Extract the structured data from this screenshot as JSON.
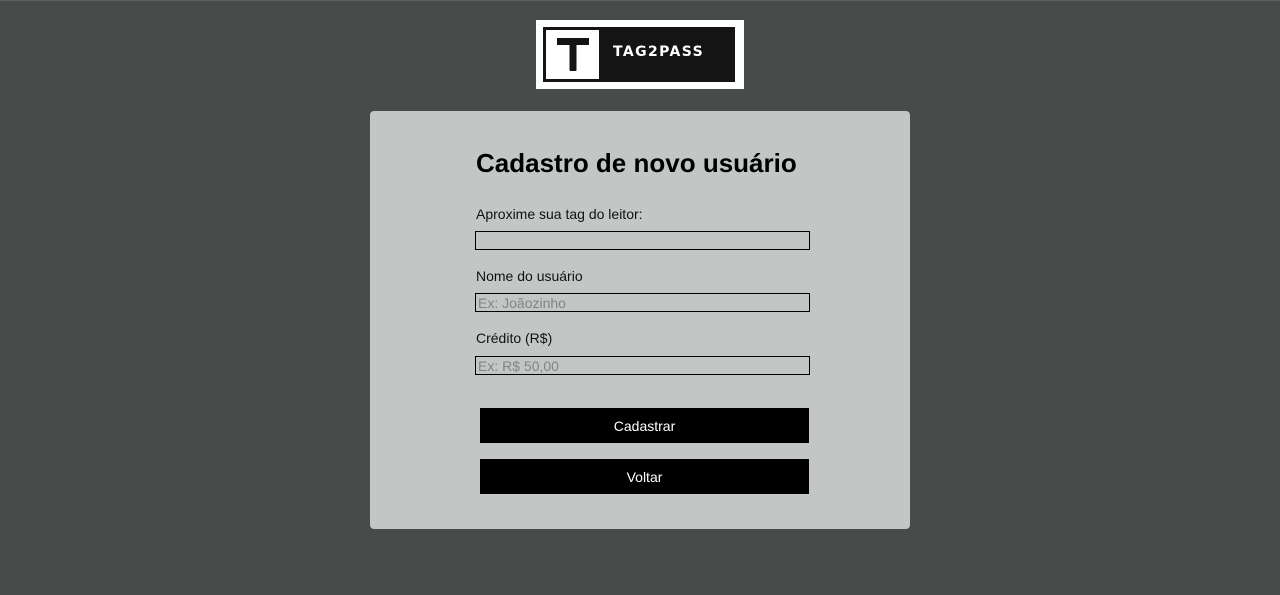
{
  "logo": {
    "mark_letter": "T",
    "brand_text": "TAG2PASS"
  },
  "form": {
    "title": "Cadastro de novo usuário",
    "tag_label": "Aproxime sua tag do leitor:",
    "tag_value": "",
    "name_label": "Nome do usuário",
    "name_placeholder": "Ex: Joãozinho",
    "credit_label": "Crédito (R$)",
    "credit_placeholder": "Ex: R$ 50,00",
    "submit_label": "Cadastrar",
    "back_label": "Voltar"
  },
  "colors": {
    "page_background": "#474c4a",
    "card_background": "#c2c7c6",
    "button_background": "#000000",
    "button_text": "#ffffff"
  }
}
